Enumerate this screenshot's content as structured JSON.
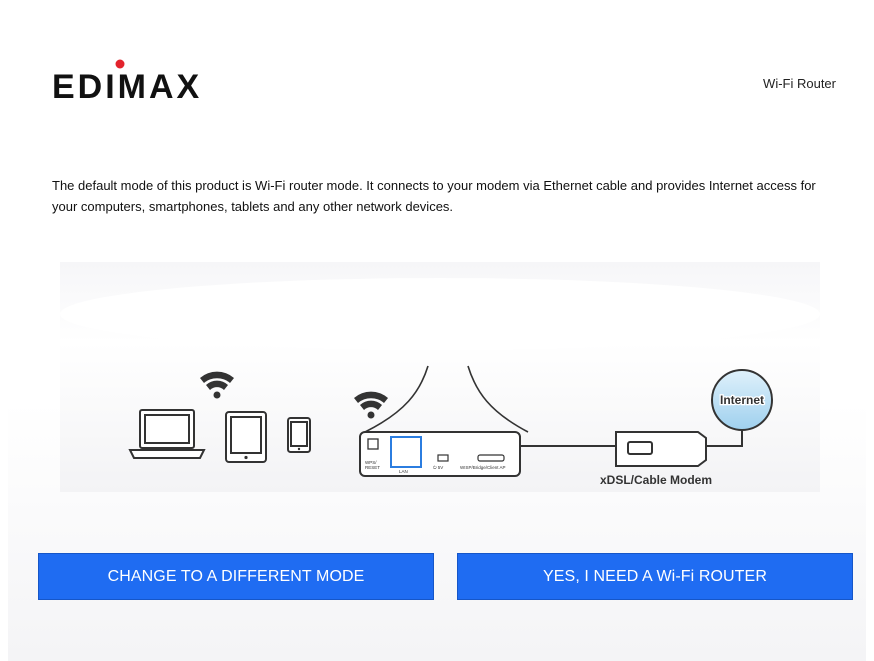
{
  "header": {
    "brand": "EDIMAX",
    "product_name": "Wi-Fi Router"
  },
  "description": "The default mode of this product is Wi-Fi router mode. It connects to your modem via Ethernet cable and provides Internet access for your computers, smartphones, tablets and any other network devices.",
  "diagram": {
    "internet_label": "Internet",
    "modem_label": "xDSL/Cable Modem",
    "router_port_labels": [
      "WPS/RESET",
      "LAN",
      "5V",
      "WISP/Bridge/Client AP"
    ]
  },
  "buttons": {
    "change_mode": "CHANGE TO A DIFFERENT MODE",
    "confirm_router": "YES, I NEED A Wi-Fi ROUTER"
  },
  "colors": {
    "button_blue": "#1f6cf2",
    "lan_port_blue": "#2b7de0",
    "logo_red": "#e3232c"
  }
}
